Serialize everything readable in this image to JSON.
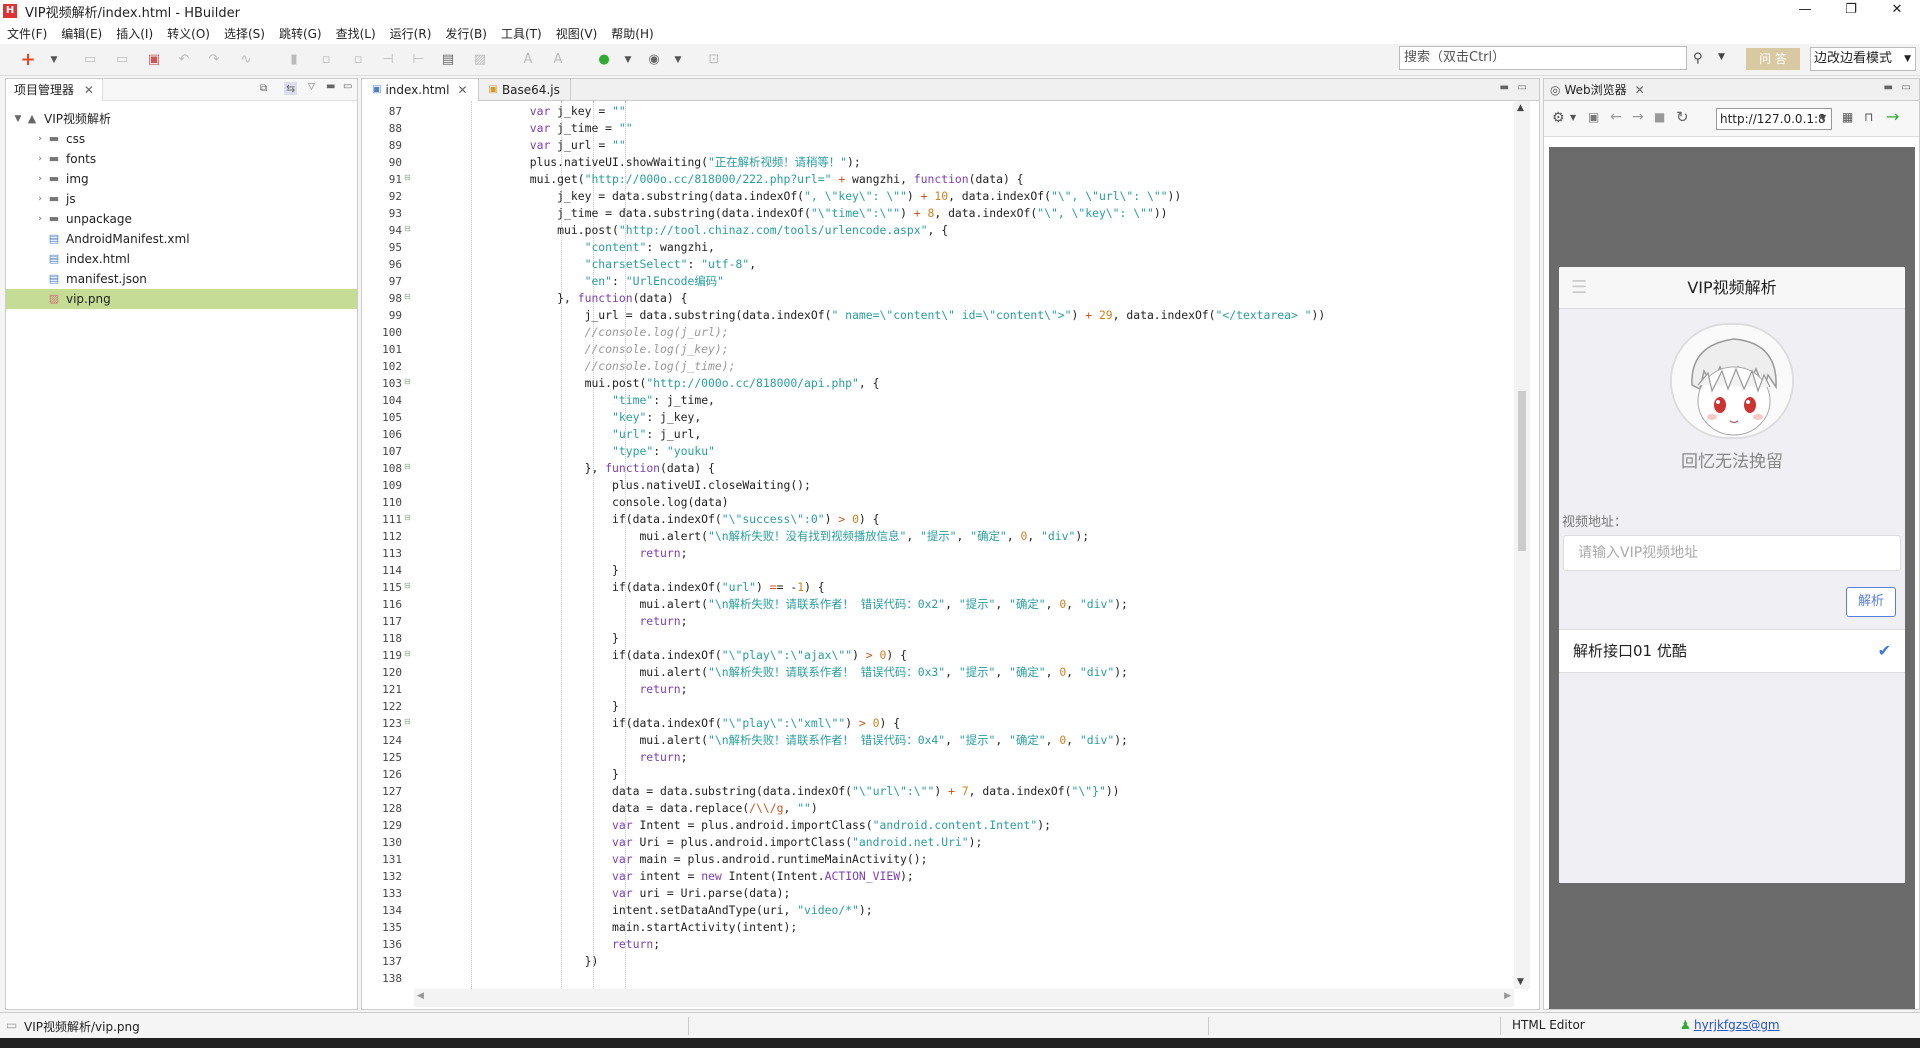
{
  "window": {
    "title": "VIP视频解析/index.html  -  HBuilder",
    "minimize": "—",
    "maximize": "❐",
    "close": "✕"
  },
  "menu": [
    "文件(F)",
    "编辑(E)",
    "插入(I)",
    "转义(O)",
    "选择(S)",
    "跳转(G)",
    "查找(L)",
    "运行(R)",
    "发行(B)",
    "工具(T)",
    "视图(V)",
    "帮助(H)"
  ],
  "toolbar": {
    "search_placeholder": "搜索（双击Ctrl）",
    "ask_label": "问 答",
    "mode_label": "边改边看模式"
  },
  "project": {
    "tab_label": "项目管理器",
    "root": "VIP视频解析",
    "items": [
      {
        "label": "css",
        "type": "folder"
      },
      {
        "label": "fonts",
        "type": "folder"
      },
      {
        "label": "img",
        "type": "folder"
      },
      {
        "label": "js",
        "type": "folder"
      },
      {
        "label": "unpackage",
        "type": "folder"
      },
      {
        "label": "AndroidManifest.xml",
        "type": "file"
      },
      {
        "label": "index.html",
        "type": "file"
      },
      {
        "label": "manifest.json",
        "type": "file"
      },
      {
        "label": "vip.png",
        "type": "image",
        "selected": true
      }
    ]
  },
  "editor": {
    "tabs": [
      {
        "label": "index.html",
        "active": true
      },
      {
        "label": "Base64.js",
        "active": false
      }
    ],
    "lines": [
      {
        "n": 87,
        "text": "                var j_key = \"\""
      },
      {
        "n": 88,
        "text": "                var j_time = \"\""
      },
      {
        "n": 89,
        "text": "                var j_url = \"\""
      },
      {
        "n": 90,
        "text": "                plus.nativeUI.showWaiting(\"正在解析视频！请稍等！\");"
      },
      {
        "n": 91,
        "text": "                mui.get(\"http://000o.cc/818000/222.php?url=\" + wangzhi, function(data) {",
        "fold": true
      },
      {
        "n": 92,
        "text": "                    j_key = data.substring(data.indexOf(\", \\\"key\\\": \\\"\") + 10, data.indexOf(\"\\\", \\\"url\\\": \\\"\"))"
      },
      {
        "n": 93,
        "text": "                    j_time = data.substring(data.indexOf(\"\\\"time\\\":\\\"\") + 8, data.indexOf(\"\\\", \\\"key\\\": \\\"\"))"
      },
      {
        "n": 94,
        "text": "                    mui.post(\"http://tool.chinaz.com/tools/urlencode.aspx\", {",
        "fold": true
      },
      {
        "n": 95,
        "text": "                        \"content\": wangzhi,"
      },
      {
        "n": 96,
        "text": "                        \"charsetSelect\": \"utf-8\","
      },
      {
        "n": 97,
        "text": "                        \"en\": \"UrlEncode编码\""
      },
      {
        "n": 98,
        "text": "                    }, function(data) {",
        "fold": true
      },
      {
        "n": 99,
        "text": "                        j_url = data.substring(data.indexOf(\" name=\\\"content\\\" id=\\\"content\\\">\") + 29, data.indexOf(\"</textarea> \"))"
      },
      {
        "n": 100,
        "text": "                        //console.log(j_url);"
      },
      {
        "n": 101,
        "text": "                        //console.log(j_key);"
      },
      {
        "n": 102,
        "text": "                        //console.log(j_time);"
      },
      {
        "n": 103,
        "text": "                        mui.post(\"http://000o.cc/818000/api.php\", {",
        "fold": true
      },
      {
        "n": 104,
        "text": "                            \"time\": j_time,"
      },
      {
        "n": 105,
        "text": "                            \"key\": j_key,"
      },
      {
        "n": 106,
        "text": "                            \"url\": j_url,"
      },
      {
        "n": 107,
        "text": "                            \"type\": \"youku\""
      },
      {
        "n": 108,
        "text": "                        }, function(data) {",
        "fold": true
      },
      {
        "n": 109,
        "text": "                            plus.nativeUI.closeWaiting();"
      },
      {
        "n": 110,
        "text": "                            console.log(data)"
      },
      {
        "n": 111,
        "text": "                            if(data.indexOf(\"\\\"success\\\":0\") > 0) {",
        "fold": true
      },
      {
        "n": 112,
        "text": "                                mui.alert(\"\\n解析失败！没有找到视频播放信息\", \"提示\", \"确定\", 0, \"div\");"
      },
      {
        "n": 113,
        "text": "                                return;"
      },
      {
        "n": 114,
        "text": "                            }"
      },
      {
        "n": 115,
        "text": "                            if(data.indexOf(\"url\") == -1) {",
        "fold": true
      },
      {
        "n": 116,
        "text": "                                mui.alert(\"\\n解析失败！请联系作者！ 错误代码：0x2\", \"提示\", \"确定\", 0, \"div\");"
      },
      {
        "n": 117,
        "text": "                                return;"
      },
      {
        "n": 118,
        "text": "                            }"
      },
      {
        "n": 119,
        "text": "                            if(data.indexOf(\"\\\"play\\\":\\\"ajax\\\"\") > 0) {",
        "fold": true
      },
      {
        "n": 120,
        "text": "                                mui.alert(\"\\n解析失败！请联系作者！ 错误代码：0x3\", \"提示\", \"确定\", 0, \"div\");"
      },
      {
        "n": 121,
        "text": "                                return;"
      },
      {
        "n": 122,
        "text": "                            }"
      },
      {
        "n": 123,
        "text": "                            if(data.indexOf(\"\\\"play\\\":\\\"xml\\\"\") > 0) {",
        "fold": true
      },
      {
        "n": 124,
        "text": "                                mui.alert(\"\\n解析失败！请联系作者！ 错误代码：0x4\", \"提示\", \"确定\", 0, \"div\");"
      },
      {
        "n": 125,
        "text": "                                return;"
      },
      {
        "n": 126,
        "text": "                            }"
      },
      {
        "n": 127,
        "text": "                            data = data.substring(data.indexOf(\"\\\"url\\\":\\\"\") + 7, data.indexOf(\"\\\"}\"))"
      },
      {
        "n": 128,
        "text": "                            data = data.replace(/\\\\/g, \"\")"
      },
      {
        "n": 129,
        "text": "                            var Intent = plus.android.importClass(\"android.content.Intent\");"
      },
      {
        "n": 130,
        "text": "                            var Uri = plus.android.importClass(\"android.net.Uri\");"
      },
      {
        "n": 131,
        "text": "                            var main = plus.android.runtimeMainActivity();"
      },
      {
        "n": 132,
        "text": "                            var intent = new Intent(Intent.ACTION_VIEW);"
      },
      {
        "n": 133,
        "text": "                            var uri = Uri.parse(data);"
      },
      {
        "n": 134,
        "text": "                            intent.setDataAndType(uri, \"video/*\");"
      },
      {
        "n": 135,
        "text": "                            main.startActivity(intent);"
      },
      {
        "n": 136,
        "text": "                            return;"
      },
      {
        "n": 137,
        "text": "                        })"
      },
      {
        "n": 138,
        "text": ""
      }
    ]
  },
  "browser": {
    "tab_label": "Web浏览器",
    "url": "http://127.0.0.1:8",
    "app": {
      "title": "VIP视频解析",
      "slogan": "回忆无法挽留",
      "address_label": "视频地址：",
      "address_placeholder": "请输入VIP视频地址",
      "parse_button": "解析",
      "api_option": "解析接口01 优酷"
    }
  },
  "status": {
    "left": "VIP视频解析/vip.png",
    "editor_type": "HTML Editor",
    "user": "hyrjkfgzs@gm"
  },
  "colors": {
    "selection": "#c4dc93",
    "keyword": "#7b3fb5",
    "string": "#2a9d9d",
    "comment": "#999999",
    "number": "#d08020",
    "accent_blue": "#5b7fd6"
  }
}
